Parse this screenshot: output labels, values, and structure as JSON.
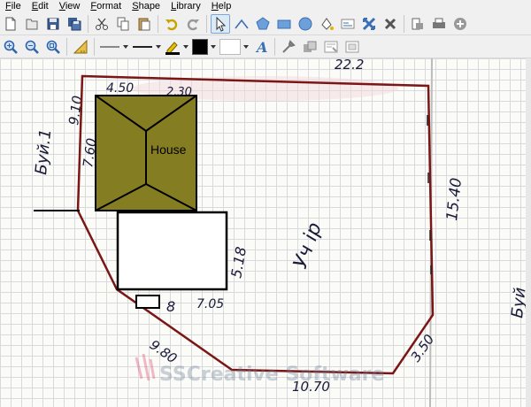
{
  "menu": [
    "File",
    "Edit",
    "View",
    "Format",
    "Shape",
    "Library",
    "Help"
  ],
  "toolbar1": {
    "icons": [
      "new-document-icon",
      "open-icon",
      "save-icon",
      "save-all-icon",
      "cut-icon",
      "copy-icon",
      "paste-icon",
      "undo-icon",
      "redo-icon",
      "pointer-icon",
      "line-tool-icon",
      "polygon-tool-icon",
      "rectangle-tool-icon",
      "ellipse-tool-icon",
      "fill-tool-icon",
      "text-tool-icon",
      "flip-icon",
      "delete-icon",
      "page-icon",
      "print-icon",
      "add-icon"
    ]
  },
  "toolbar2": {
    "icons": [
      "zoom-in-icon",
      "zoom-out-icon",
      "zoom-fit-icon",
      "ruler-icon",
      "line-style-icon",
      "line-width-icon",
      "pen-color-icon",
      "fill-color-icon",
      "text-style-icon",
      "tools-icon",
      "group-icon",
      "ungroup-icon",
      "align-icon"
    ]
  },
  "colors": {
    "pen": "#000000",
    "fill": "#ffffff",
    "house": "#857d22",
    "boundary": "#7a1616"
  },
  "drawing": {
    "house_label": "House",
    "handwritten": [
      "4.50",
      "2.30",
      "22.2",
      "9.10",
      "7.60",
      "Буй.1",
      "15.40",
      "Уч ір",
      "5.18",
      "8",
      "7.05",
      "9.80",
      "10.70",
      "3.50",
      "Буй"
    ],
    "watermark": "SSCreative Software"
  }
}
